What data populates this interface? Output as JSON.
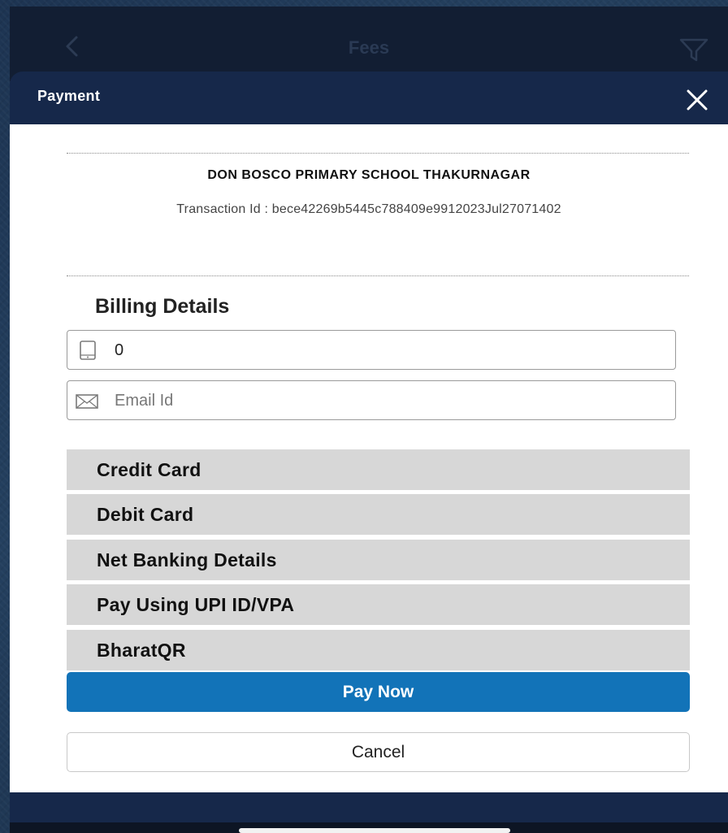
{
  "top_bar": {
    "title": "Fees",
    "back_icon": "chevron-left-icon",
    "filter_icon": "filter-icon"
  },
  "modal": {
    "title": "Payment",
    "close_icon": "close-icon",
    "school_name": "DON BOSCO PRIMARY SCHOOL THAKURNAGAR",
    "transaction": "Transaction Id : bece42269b5445c788409e9912023Jul27071402",
    "billing_title": "Billing Details",
    "phone": {
      "icon": "phone-icon",
      "value": "0"
    },
    "email": {
      "icon": "mail-icon",
      "placeholder": "Email Id",
      "value": ""
    },
    "payment_options": [
      {
        "label": "Credit Card"
      },
      {
        "label": "Debit Card"
      },
      {
        "label": "Net Banking Details"
      },
      {
        "label": "Pay Using UPI ID/VPA"
      },
      {
        "label": "BharatQR"
      }
    ],
    "pay_now_label": "Pay Now",
    "cancel_label": "Cancel"
  },
  "colors": {
    "header": "#16284a",
    "pay_now": "#1273b8",
    "option_bg": "#d7d7d7"
  }
}
